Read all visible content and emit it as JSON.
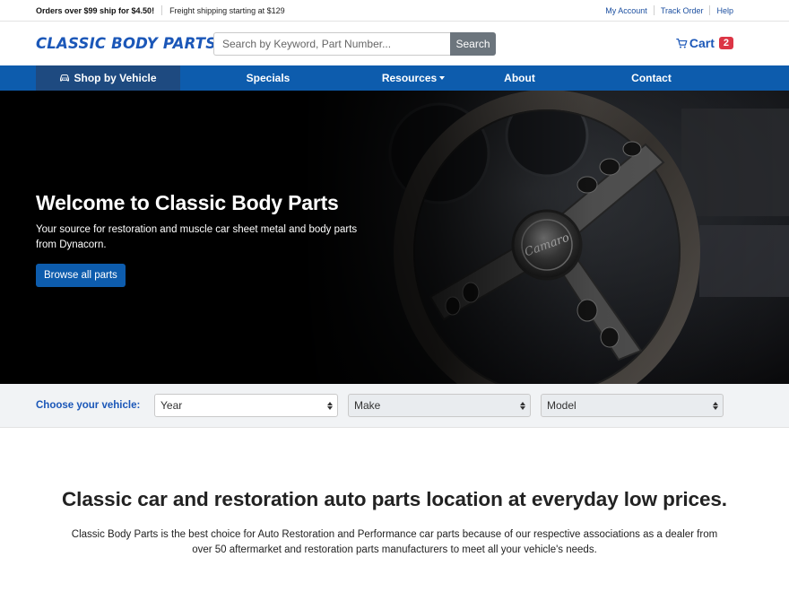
{
  "topbar": {
    "promo_1": "Orders over $99 ship for $4.50!",
    "promo_2": "Freight shipping starting at $129",
    "links": [
      "My Account",
      "Track Order",
      "Help"
    ]
  },
  "header": {
    "logo": "CLASSIC BODY PARTS",
    "search_placeholder": "Search by Keyword, Part Number...",
    "search_button": "Search",
    "cart_label": "Cart",
    "cart_count": "2"
  },
  "nav": {
    "items": [
      "Shop by Vehicle",
      "Specials",
      "Resources",
      "About",
      "Contact"
    ]
  },
  "hero": {
    "title": "Welcome to Classic Body Parts",
    "subtitle": "Your source for restoration and muscle car sheet metal and body parts from Dynacorn.",
    "cta": "Browse all parts"
  },
  "vehicle": {
    "label": "Choose your vehicle:",
    "year": "Year",
    "make": "Make",
    "model": "Model"
  },
  "main": {
    "heading": "Classic car and restoration auto parts location at everyday low prices.",
    "body": "Classic Body Parts is the best choice for Auto Restoration and Performance car parts because of our respective associations as a dealer from over 50 aftermarket and restoration parts manufacturers to meet all your vehicle's needs."
  },
  "colors": {
    "brand_blue": "#1b57b8",
    "nav_blue": "#0d5cad",
    "nav_active": "#1e4a80",
    "badge_red": "#dc3545",
    "search_button_gray": "#6c757d"
  },
  "icons": [
    "cart-icon",
    "car-icon",
    "caret-down-icon",
    "select-arrows-icon",
    "steering-wheel-image"
  ]
}
